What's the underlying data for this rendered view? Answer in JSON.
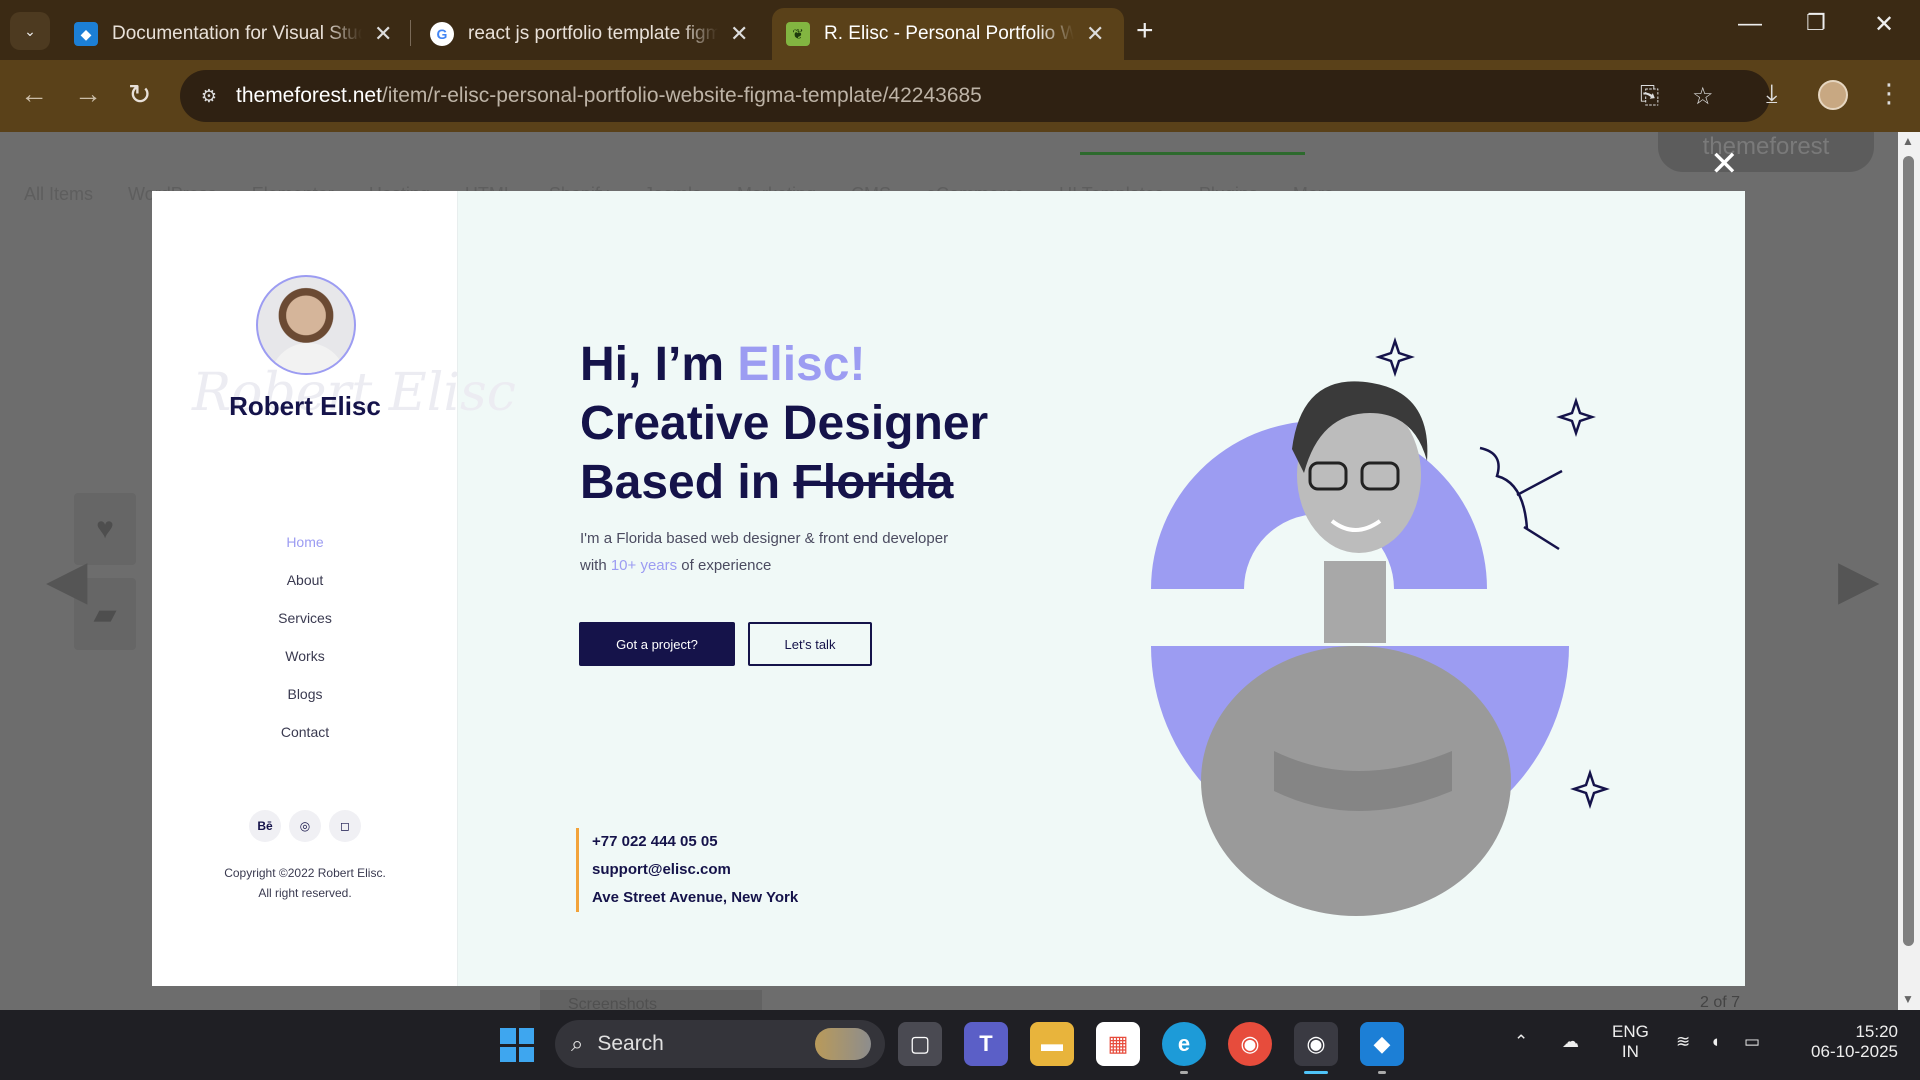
{
  "browser": {
    "tabs": [
      {
        "title": "Documentation for Visual Studio Code",
        "icon": "vscode-icon",
        "active": false
      },
      {
        "title": "react js portfolio template figma - Google Search",
        "icon": "google-icon",
        "active": false
      },
      {
        "title": "R. Elisc - Personal Portfolio Website Figma Template",
        "icon": "envato-icon",
        "active": true
      }
    ],
    "url_domain": "themeforest.net",
    "url_path": "/item/r-elisc-personal-portfolio-website-figma-template/42243685"
  },
  "page": {
    "nav_items": [
      "All Items",
      "WordPress",
      "Elementor",
      "Hosting",
      "HTML",
      "Shopify",
      "Joomla",
      "Marketing",
      "CMS",
      "eCommerce",
      "UI Templates",
      "Plugins",
      "More"
    ],
    "brand": "themeforest",
    "counter": "2 of 7",
    "screenshots_label": "Screenshots"
  },
  "preview": {
    "signature": "Robert Elisc",
    "name": "Robert Elisc",
    "menu": [
      {
        "label": "Home",
        "active": true
      },
      {
        "label": "About",
        "active": false
      },
      {
        "label": "Services",
        "active": false
      },
      {
        "label": "Works",
        "active": false
      },
      {
        "label": "Blogs",
        "active": false
      },
      {
        "label": "Contact",
        "active": false
      }
    ],
    "socials": [
      "Bē",
      "◎",
      "◻"
    ],
    "copyright_line1": "Copyright ©2022 Robert Elisc.",
    "copyright_line2": "All right reserved.",
    "hero": {
      "line1_prefix": "Hi, I’m ",
      "line1_accent": "Elisc!",
      "line2": "Creative Designer",
      "line3_prefix": "Based in ",
      "line3_strike": "Florida"
    },
    "desc_part1": "I'm a Florida based web designer & front  end developer with ",
    "desc_highlight": "10+ years",
    "desc_part2": " of experience",
    "primary_button": "Got a project?",
    "secondary_button": "Let's talk",
    "phone": "+77 022 444 05 05",
    "email": "support@elisc.com",
    "address": "Ave Street Avenue, New York",
    "colors": {
      "accent": "#9c9cf2",
      "navy": "#15134a",
      "orange": "#f2a33a",
      "bg": "#f0f9f7"
    }
  },
  "taskbar": {
    "search_label": "Search",
    "lang": "ENG",
    "region": "IN",
    "time": "15:20",
    "date": "06-10-2025"
  }
}
